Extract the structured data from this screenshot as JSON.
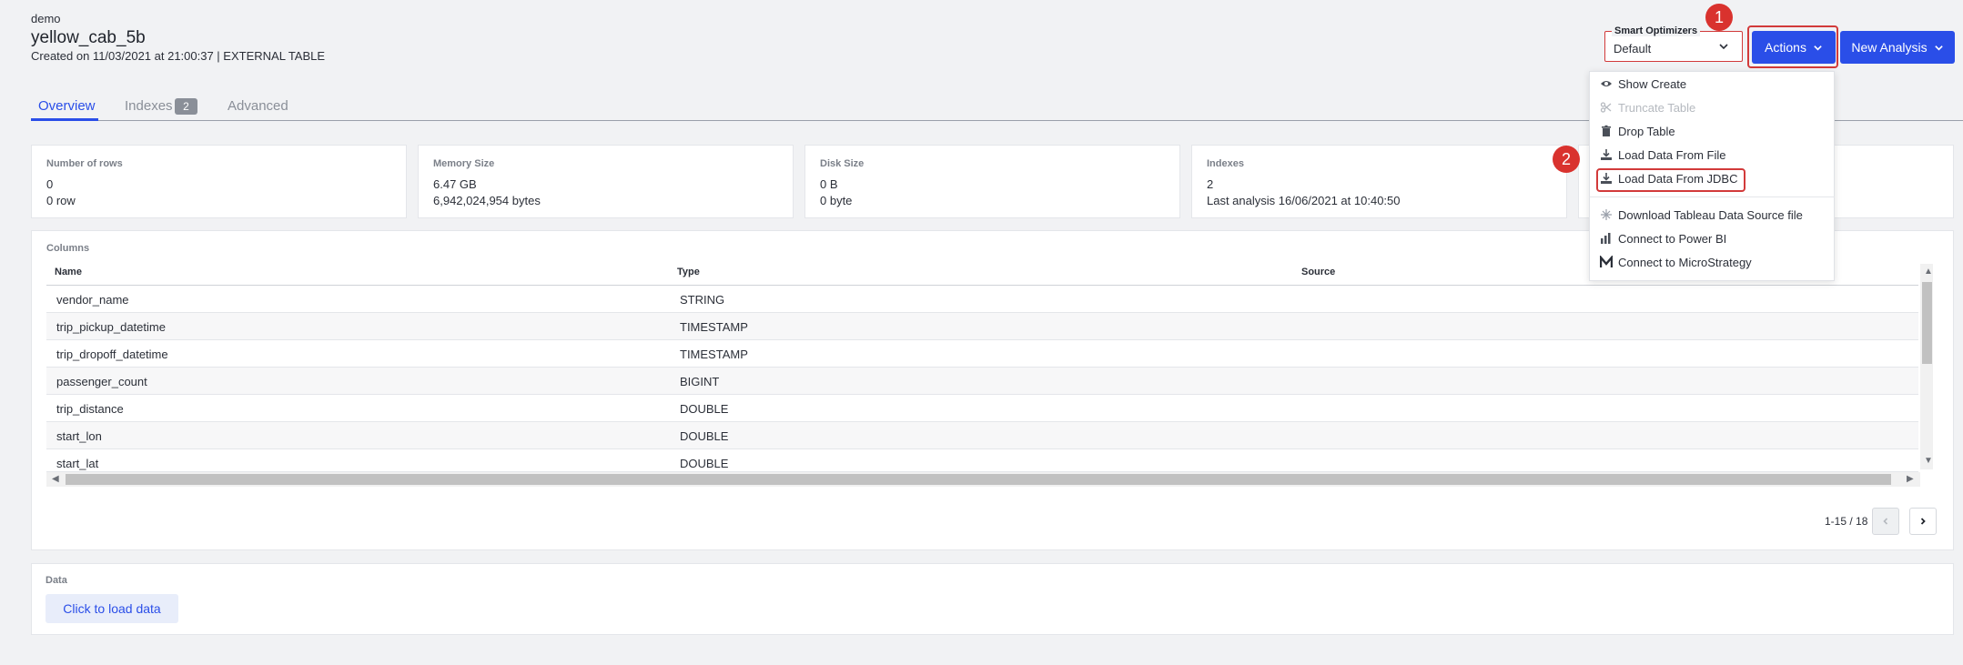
{
  "header": {
    "breadcrumb": "demo",
    "title": "yellow_cab_5b",
    "subtitle": "Created on 11/03/2021 at 21:00:37 | EXTERNAL TABLE"
  },
  "optimizer": {
    "label": "Smart Optimizers",
    "value": "Default"
  },
  "buttons": {
    "actions": "Actions",
    "new_analysis": "New Analysis",
    "load_data": "Click to load data"
  },
  "badges": {
    "one": "1",
    "two": "2"
  },
  "tabs": [
    {
      "label": "Overview",
      "active": true
    },
    {
      "label": "Indexes",
      "count": "2"
    },
    {
      "label": "Advanced"
    }
  ],
  "stats": [
    {
      "label": "Number of rows",
      "value": "0",
      "detail": "0 row"
    },
    {
      "label": "Memory Size",
      "value": "6.47 GB",
      "detail": "6,942,024,954 bytes"
    },
    {
      "label": "Disk Size",
      "value": "0 B",
      "detail": "0 byte"
    },
    {
      "label": "Indexes",
      "value": "2",
      "detail": "Last analysis 16/06/2021 at 10:40:50"
    }
  ],
  "columns": {
    "title": "Columns",
    "headers": [
      "Name",
      "Type",
      "Source"
    ],
    "rows": [
      {
        "name": "vendor_name",
        "type": "STRING"
      },
      {
        "name": "trip_pickup_datetime",
        "type": "TIMESTAMP"
      },
      {
        "name": "trip_dropoff_datetime",
        "type": "TIMESTAMP"
      },
      {
        "name": "passenger_count",
        "type": "BIGINT"
      },
      {
        "name": "trip_distance",
        "type": "DOUBLE"
      },
      {
        "name": "start_lon",
        "type": "DOUBLE"
      },
      {
        "name": "start_lat",
        "type": "DOUBLE"
      }
    ],
    "pagination": "1-15 / 18"
  },
  "data_section": {
    "title": "Data"
  },
  "actions_menu": [
    {
      "label": "Show Create",
      "icon": "eye-icon",
      "disabled": false
    },
    {
      "label": "Truncate Table",
      "icon": "scissors-icon",
      "disabled": true
    },
    {
      "label": "Drop Table",
      "icon": "trash-icon",
      "disabled": false
    },
    {
      "label": "Load Data From File",
      "icon": "download-icon",
      "disabled": false
    },
    {
      "label": "Load Data From JDBC",
      "icon": "download-icon",
      "disabled": false
    },
    {
      "label": "Download Tableau Data Source file",
      "icon": "tableau-icon",
      "disabled": false
    },
    {
      "label": "Connect to Power BI",
      "icon": "powerbi-icon",
      "disabled": false
    },
    {
      "label": "Connect to MicroStrategy",
      "icon": "microstrategy-icon",
      "disabled": false
    }
  ],
  "colors": {
    "accent": "#2a4ee8",
    "highlight": "#d23a3a",
    "badge": "#d9322e"
  }
}
